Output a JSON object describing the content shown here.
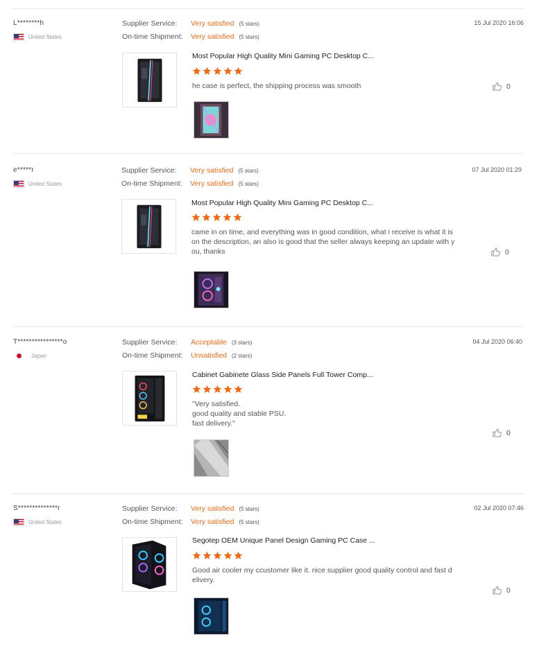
{
  "reviews": [
    {
      "buyer": "L********h",
      "country": "United States",
      "flag": "us",
      "date": "15 Jul 2020 16:06",
      "supplier_label": "Supplier Service:",
      "supplier_value": "Very satisfied",
      "supplier_stars": "(5 stars)",
      "shipment_label": "On-time Shipment:",
      "shipment_value": "Very satisfied",
      "shipment_stars": "(5 stars)",
      "product_title": "Most Popular High Quality Mini Gaming PC Desktop C...",
      "rating": 5,
      "text": "he case is perfect, the shipping process was smooth",
      "likes": "0"
    },
    {
      "buyer": "e*****r",
      "country": "United States",
      "flag": "us",
      "date": "07 Jul 2020 01:29",
      "supplier_label": "Supplier Service:",
      "supplier_value": "Very satisfied",
      "supplier_stars": "(5 stars)",
      "shipment_label": "On-time Shipment:",
      "shipment_value": "Very satisfied",
      "shipment_stars": "(5 stars)",
      "product_title": "Most Popular High Quality Mini Gaming PC Desktop C...",
      "rating": 5,
      "text": "came in on time, and everything was in good condition, what i receive is what it is\non the description, an also is good that the seller always keeping an update with y\nou, thanks",
      "likes": "0"
    },
    {
      "buyer": "T****************o",
      "country": "Japan",
      "flag": "jp",
      "date": "04 Jul 2020 06:40",
      "supplier_label": "Supplier Service:",
      "supplier_value": "Acceptable",
      "supplier_stars": "(3 stars)",
      "shipment_label": "On-time Shipment:",
      "shipment_value": "Unsatisfied",
      "shipment_stars": "(2 stars)",
      "product_title": "Cabinet Gabinete Glass Side Panels Full Tower Comp...",
      "rating": 5,
      "text": "\"Very satisfied.\ngood quality and stable PSU.\nfast delivery.\"",
      "likes": "0"
    },
    {
      "buyer": "S**************r",
      "country": "United States",
      "flag": "us",
      "date": "02 Jul 2020 07:46",
      "supplier_label": "Supplier Service:",
      "supplier_value": "Very satisfied",
      "supplier_stars": "(5 stars)",
      "shipment_label": "On-time Shipment:",
      "shipment_value": "Very satisfied",
      "shipment_stars": "(5 stars)",
      "product_title": "Segotep OEM Unique Panel Design Gaming PC Case ...",
      "rating": 5,
      "text": "Good air cooler my ccustomer like it. nice supplier good quality control and fast d\nelivery.",
      "likes": "0"
    }
  ],
  "colors": {
    "accent": "#f06a16",
    "star": "#f06a16",
    "divider": "#e6e6e6"
  },
  "icons": {
    "star": "star-icon",
    "like": "thumbs-up-icon",
    "us_flag": "us-flag-icon",
    "jp_flag": "japan-flag-icon"
  }
}
